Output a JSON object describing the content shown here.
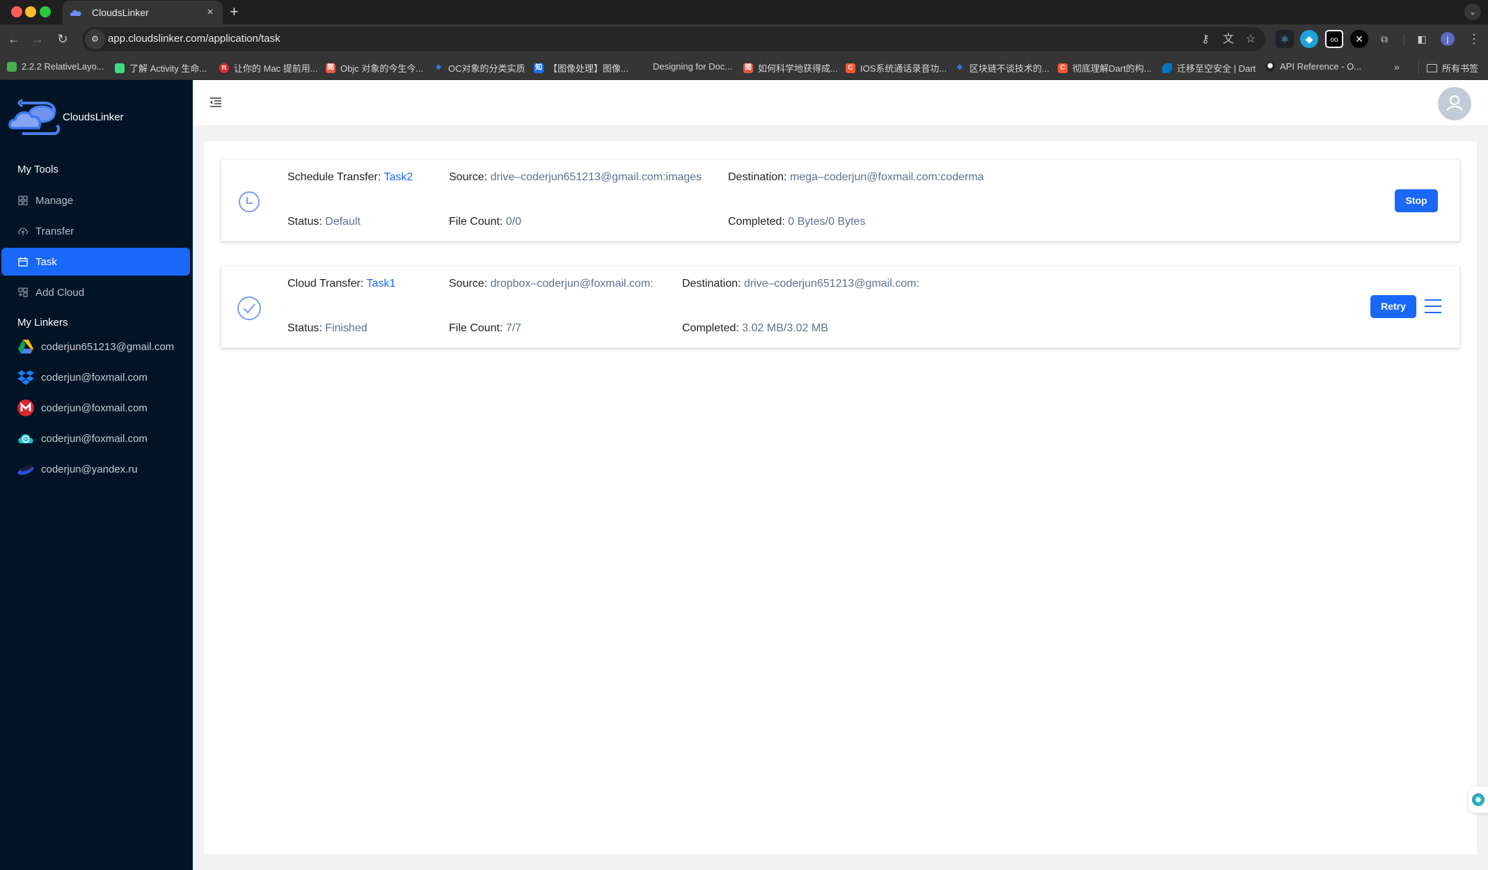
{
  "browser": {
    "tab_title": "CloudsLinker",
    "new_tab": "+",
    "tab_close": "×",
    "url": "app.cloudslinker.com/application/task",
    "profile_initial": "j",
    "bookmarks": [
      {
        "label": "2.2.2 RelativeLayo...",
        "color": "#4caf50"
      },
      {
        "label": "了解 Activity 生命...",
        "color": "#3ddc84"
      },
      {
        "label": "让你的 Mac 提前用...",
        "color": "#d32f2f"
      },
      {
        "label": "Objc 对象的今生今...",
        "color": "#e8573e"
      },
      {
        "label": "OC对象的分类实质",
        "color": "#3e7bfa"
      },
      {
        "label": "【图像处理】图像...",
        "color": "#1772f6"
      },
      {
        "label": "Designing for Doc...",
        "color": "#999999"
      },
      {
        "label": "如何科学地获得成...",
        "color": "#e8573e"
      },
      {
        "label": "IOS系统通话录音功...",
        "color": "#fc5531"
      },
      {
        "label": "区块链不谈技术的...",
        "color": "#3e7bfa"
      },
      {
        "label": "彻底理解Dart的构...",
        "color": "#fc5531"
      },
      {
        "label": "迁移至空安全 | Dart",
        "color": "#0175c2"
      },
      {
        "label": "API Reference - O...",
        "color": "#222222"
      }
    ],
    "bookmarks_overflow": "»",
    "all_bookmarks": "所有书签"
  },
  "app": {
    "brand": "CloudsLinker",
    "sections": {
      "tools": "My Tools",
      "linkers": "My Linkers"
    },
    "menu": [
      {
        "label": "Manage",
        "icon": "grid-icon",
        "active": false
      },
      {
        "label": "Transfer",
        "icon": "cloud-upload-icon",
        "active": false
      },
      {
        "label": "Task",
        "icon": "calendar-icon",
        "active": true
      },
      {
        "label": "Add Cloud",
        "icon": "add-grid-icon",
        "active": false
      }
    ],
    "linkers": [
      {
        "label": "coderjun651213@gmail.com",
        "service": "google-drive"
      },
      {
        "label": "coderjun@foxmail.com",
        "service": "dropbox"
      },
      {
        "label": "coderjun@foxmail.com",
        "service": "mega"
      },
      {
        "label": "coderjun@foxmail.com",
        "service": "pcloud"
      },
      {
        "label": "coderjun@yandex.ru",
        "service": "yandex-disk"
      }
    ]
  },
  "tasks": [
    {
      "type_label": "Schedule Transfer:",
      "name": "Task2",
      "icon": "clock-icon",
      "source_label": "Source:",
      "source": "drive–coderjun651213@gmail.com:images",
      "destination_label": "Destination:",
      "destination": "mega–coderjun@foxmail.com:coderma",
      "status_label": "Status:",
      "status": "Default",
      "file_count_label": "File Count:",
      "file_count": "0/0",
      "completed_label": "Completed:",
      "completed": "0 Bytes/0 Bytes",
      "action": "Stop"
    },
    {
      "type_label": "Cloud Transfer:",
      "name": "Task1",
      "icon": "check-circle-icon",
      "source_label": "Source:",
      "source": "dropbox–coderjun@foxmail.com:",
      "destination_label": "Destination:",
      "destination": "drive–coderjun651213@gmail.com:",
      "status_label": "Status:",
      "status": "Finished",
      "file_count_label": "File Count:",
      "file_count": "7/7",
      "completed_label": "Completed:",
      "completed": "3.02 MB/3.02 MB",
      "action": "Retry"
    }
  ],
  "colors": {
    "accent": "#1a68f8",
    "sidebar_bg": "#001426",
    "value_text": "#5f7090",
    "icon_blue": "#7d9cf0"
  }
}
